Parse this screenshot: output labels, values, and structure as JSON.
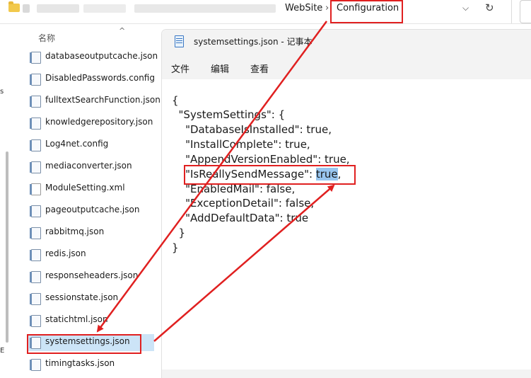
{
  "explorer": {
    "breadcrumb": [
      "WebSite",
      "Configuration"
    ],
    "separator": "›",
    "dropdown_icon": "chevron-down-icon",
    "refresh_icon": "refresh-icon",
    "column_header": "名称",
    "files": [
      "databaseoutputcache.json",
      "DisabledPasswords.config",
      "fulltextSearchFunction.json",
      "knowledgerepository.json",
      "Log4net.config",
      "mediaconverter.json",
      "ModuleSetting.xml",
      "pageoutputcache.json",
      "rabbitmq.json",
      "redis.json",
      "responseheaders.json",
      "sessionstate.json",
      "statichtml.json",
      "systemsettings.json",
      "timingtasks.json"
    ],
    "selected_file": "systemsettings.json",
    "left_fragments": [
      "s",
      "E"
    ]
  },
  "notepad": {
    "title": "systemsettings.json - 记事本",
    "menus": [
      "文件",
      "编辑",
      "查看"
    ],
    "lines": [
      "{",
      "  \"SystemSettings\": {",
      "    \"DatabaseIsInstalled\": true,",
      "    \"InstallComplete\": true,",
      "    \"AppendVersionEnabled\": true,",
      "    \"IsReallySendMessage\": ",
      "    \"EnabledMail\": false,",
      "    \"ExceptionDetail\": false,",
      "    \"AddDefaultData\": true",
      "  }",
      "}"
    ],
    "selected_value": "true",
    "after_selection": ","
  },
  "annotation_color": "#e02020",
  "selection_color": "#99c6ef"
}
